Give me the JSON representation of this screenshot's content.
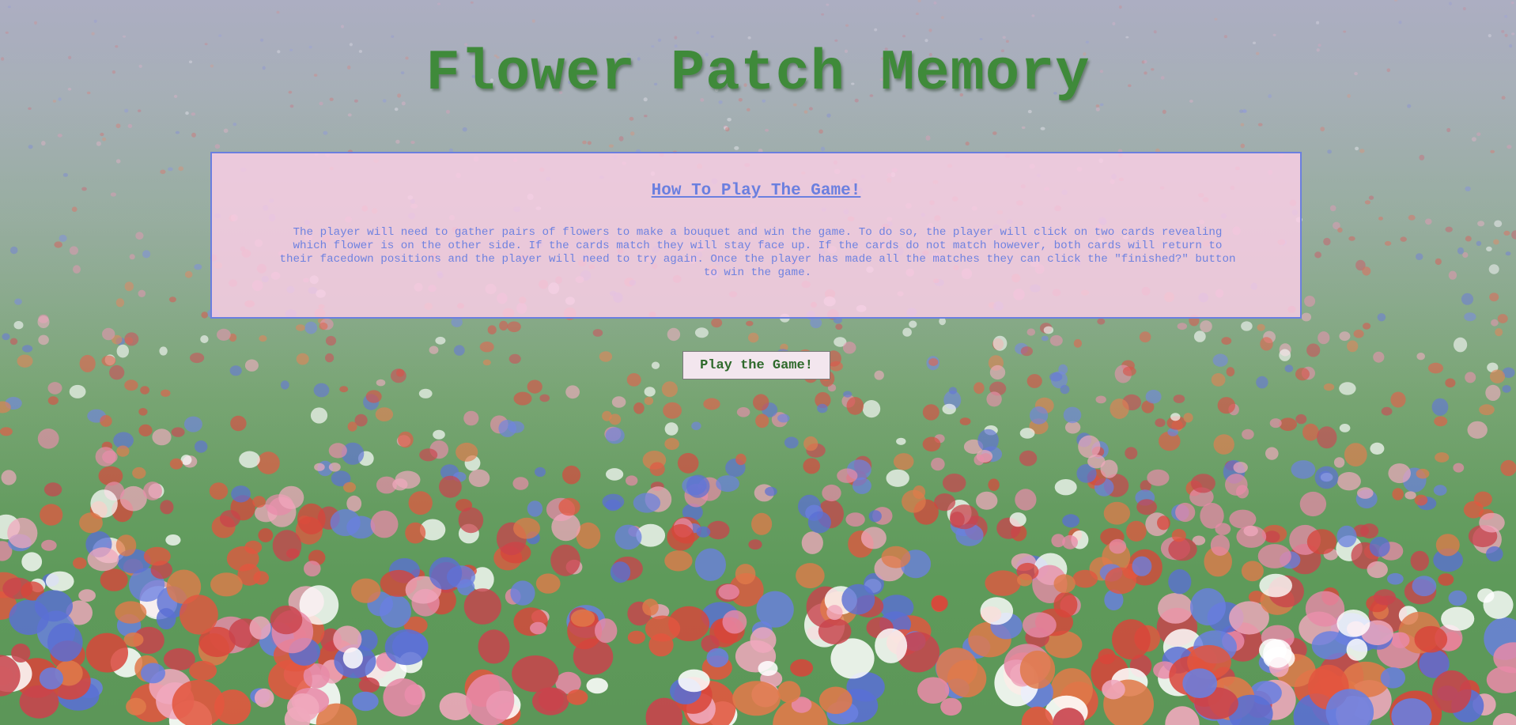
{
  "page": {
    "title": "Flower Patch Memory"
  },
  "instructions": {
    "heading": "How To Play The Game!",
    "body": "The player will need to gather pairs of flowers to make a bouquet and win the game. To do so, the player will click on two cards revealing which flower is on the other side. If the cards match they will stay face up. If the cards do not match however, both cards will return to their facedown positions and the player will need to try again. Once the player has made all the matches they can click the \"finished?\" button to win the game."
  },
  "actions": {
    "play_label": "Play the Game!"
  },
  "colors": {
    "title": "#3f8a3a",
    "panel_border": "#6b7fdf",
    "panel_text": "#6f82e0",
    "panel_bg": "#f8cde4"
  }
}
